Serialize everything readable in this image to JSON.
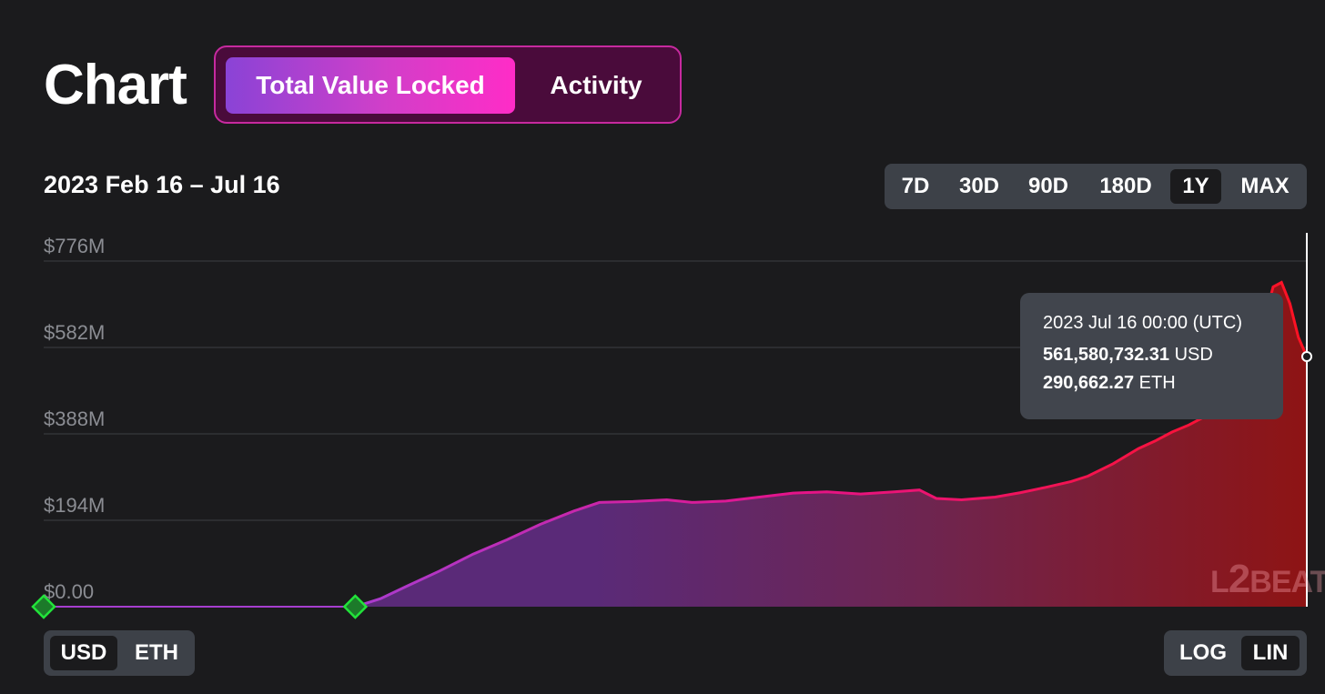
{
  "header": {
    "title": "Chart"
  },
  "tabs": [
    {
      "label": "Total Value Locked",
      "active": true
    },
    {
      "label": "Activity",
      "active": false
    }
  ],
  "date_range_label": "2023 Feb 16 – Jul 16",
  "range_buttons": [
    "7D",
    "30D",
    "90D",
    "180D",
    "1Y",
    "MAX"
  ],
  "range_selected": "1Y",
  "currency_toggle": [
    "USD",
    "ETH"
  ],
  "currency_selected": "USD",
  "scale_toggle": [
    "LOG",
    "LIN"
  ],
  "scale_selected": "LIN",
  "tooltip": {
    "date": "2023 Jul 16 00:00 (UTC)",
    "usd_value": "561,580,732.31",
    "usd_unit": "USD",
    "eth_value": "290,662.27",
    "eth_unit": "ETH"
  },
  "logo": {
    "text_left": "L",
    "text_num": "2",
    "text_right": "BEAT"
  },
  "colors": {
    "background": "#1b1b1d",
    "line_start": "#b13fd0",
    "line_end": "#ff1030",
    "marker": "#22e33a"
  },
  "chart_data": {
    "type": "area",
    "x_range": [
      "2023-02-16",
      "2023-07-16"
    ],
    "yticks": [
      {
        "value": 0,
        "label": "$0.00"
      },
      {
        "value": 194,
        "label": "$194M"
      },
      {
        "value": 388,
        "label": "$388M"
      },
      {
        "value": 582,
        "label": "$582M"
      },
      {
        "value": 776,
        "label": "$776M"
      }
    ],
    "ylim": [
      0,
      776
    ],
    "y_unit": "M USD",
    "scale": "linear",
    "grid": true,
    "markers": [
      "2023-02-16",
      "2023-03-25"
    ],
    "series": [
      {
        "values": [
          [
            "2023-02-16",
            0
          ],
          [
            "2023-03-25",
            0
          ],
          [
            "2023-03-28",
            18
          ],
          [
            "2023-03-31",
            45
          ],
          [
            "2023-04-04",
            80
          ],
          [
            "2023-04-08",
            118
          ],
          [
            "2023-04-12",
            150
          ],
          [
            "2023-04-16",
            185
          ],
          [
            "2023-04-20",
            215
          ],
          [
            "2023-04-23",
            234
          ],
          [
            "2023-04-27",
            236
          ],
          [
            "2023-05-01",
            240
          ],
          [
            "2023-05-04",
            234
          ],
          [
            "2023-05-08",
            237
          ],
          [
            "2023-05-12",
            246
          ],
          [
            "2023-05-16",
            255
          ],
          [
            "2023-05-20",
            258
          ],
          [
            "2023-05-24",
            253
          ],
          [
            "2023-05-28",
            258
          ],
          [
            "2023-05-31",
            262
          ],
          [
            "2023-06-02",
            243
          ],
          [
            "2023-06-05",
            240
          ],
          [
            "2023-06-09",
            246
          ],
          [
            "2023-06-12",
            256
          ],
          [
            "2023-06-15",
            268
          ],
          [
            "2023-06-18",
            281
          ],
          [
            "2023-06-20",
            293
          ],
          [
            "2023-06-23",
            321
          ],
          [
            "2023-06-26",
            355
          ],
          [
            "2023-06-28",
            372
          ],
          [
            "2023-06-30",
            392
          ],
          [
            "2023-07-02",
            408
          ],
          [
            "2023-07-04",
            428
          ],
          [
            "2023-07-06",
            440
          ],
          [
            "2023-07-08",
            486
          ],
          [
            "2023-07-10",
            574
          ],
          [
            "2023-07-12",
            718
          ],
          [
            "2023-07-13",
            728
          ],
          [
            "2023-07-14",
            680
          ],
          [
            "2023-07-15",
            605
          ],
          [
            "2023-07-16",
            561.58
          ]
        ]
      }
    ]
  }
}
